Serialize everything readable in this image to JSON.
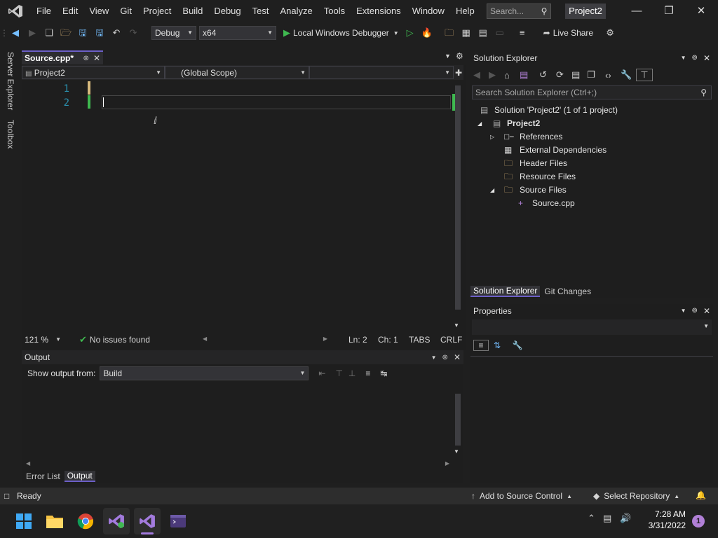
{
  "menubar": {
    "items": [
      "File",
      "Edit",
      "View",
      "Git",
      "Project",
      "Build",
      "Debug",
      "Test",
      "Analyze",
      "Tools",
      "Extensions",
      "Window",
      "Help"
    ],
    "search_label": "Search...",
    "project_title": "Project2"
  },
  "toolbar": {
    "config": "Debug",
    "platform": "x64",
    "debugger": "Local Windows Debugger",
    "live_share": "Live Share"
  },
  "left_strip": {
    "server_explorer": "Server Explorer",
    "toolbox": "Toolbox"
  },
  "editor": {
    "tab_label": "Source.cpp*",
    "nav_project": "Project2",
    "nav_scope": "(Global Scope)",
    "lines": [
      "1",
      "2"
    ],
    "zoom": "121 %",
    "issues": "No issues found",
    "ln": "Ln: 2",
    "ch": "Ch: 1",
    "tabs": "TABS",
    "eol": "CRLF"
  },
  "output": {
    "title": "Output",
    "show_from_label": "Show output from:",
    "source": "Build",
    "tab_error_list": "Error List",
    "tab_output": "Output"
  },
  "solution_explorer": {
    "title": "Solution Explorer",
    "search_placeholder": "Search Solution Explorer (Ctrl+;)",
    "solution": "Solution 'Project2' (1 of 1 project)",
    "project": "Project2",
    "items": [
      "References",
      "External Dependencies",
      "Header Files",
      "Resource Files",
      "Source Files"
    ],
    "file": "Source.cpp",
    "tab_solution": "Solution Explorer",
    "tab_git": "Git Changes"
  },
  "properties": {
    "title": "Properties"
  },
  "statusbar": {
    "ready": "Ready",
    "add_source": "Add to Source Control",
    "select_repo": "Select Repository"
  },
  "taskbar": {
    "time": "7:28 AM",
    "date": "3/31/2022",
    "notif_count": "1"
  },
  "colors": {
    "accent": "#6c5fc7",
    "ok_green": "#3fb950"
  }
}
